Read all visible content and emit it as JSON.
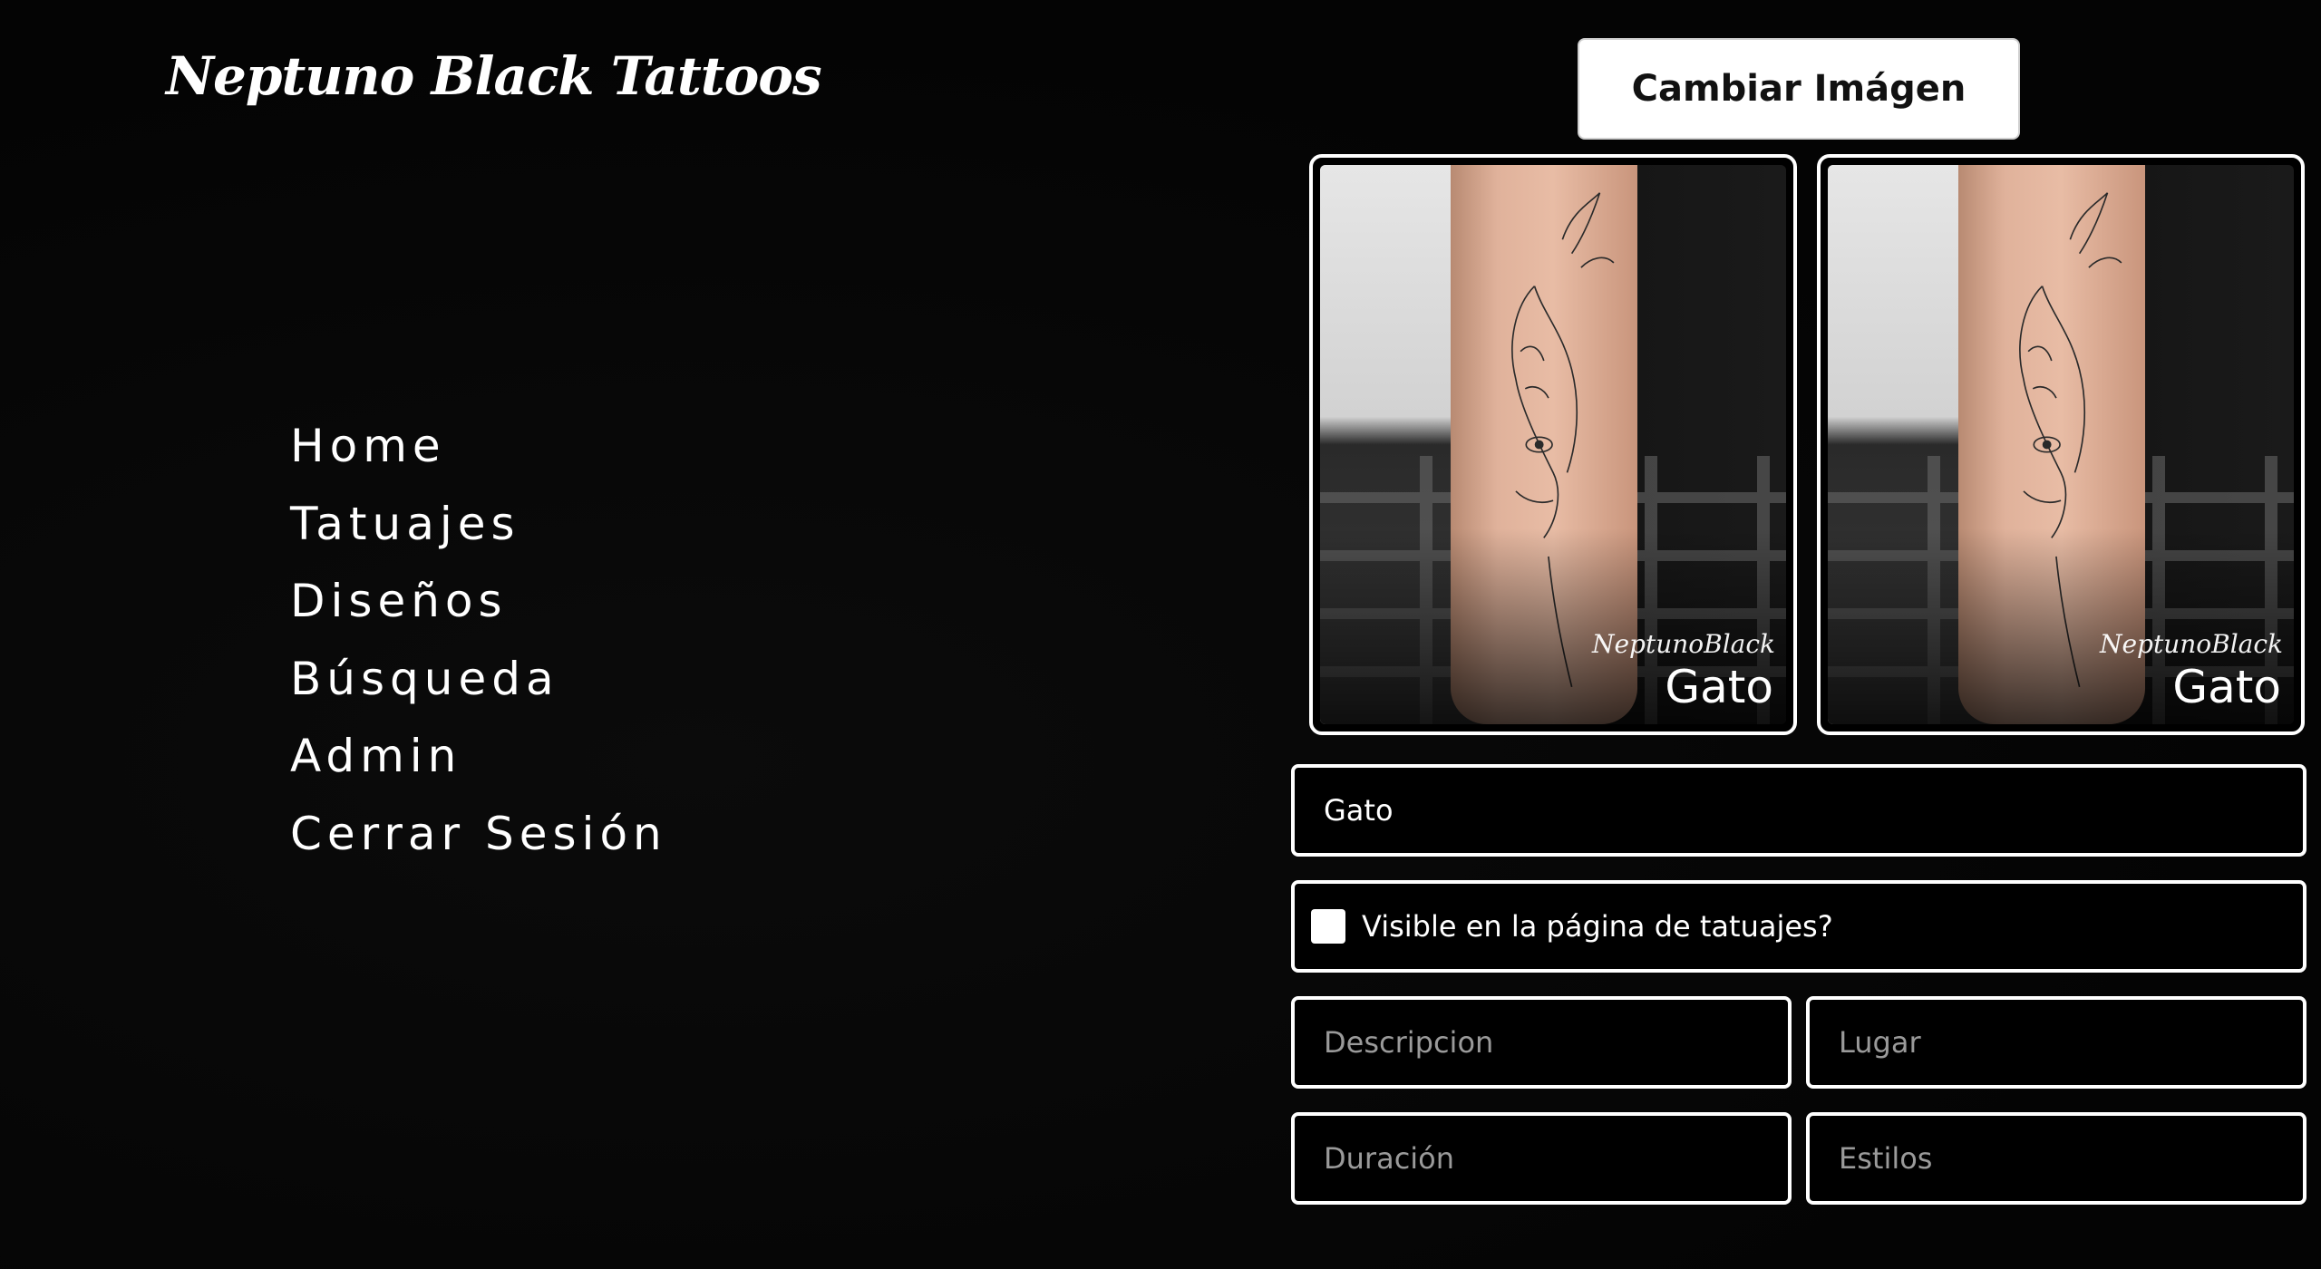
{
  "header": {
    "brand": "Neptuno Black Tattoos",
    "change_image_label": "Cambiar Imágen"
  },
  "nav": {
    "items": [
      {
        "label": "Home"
      },
      {
        "label": "Tatuajes"
      },
      {
        "label": "Diseños"
      },
      {
        "label": "Búsqueda"
      },
      {
        "label": "Admin"
      },
      {
        "label": "Cerrar Sesión"
      }
    ]
  },
  "previews": [
    {
      "caption": "Gato",
      "signature": "NeptunoBlack"
    },
    {
      "caption": "Gato",
      "signature": "NeptunoBlack"
    }
  ],
  "form": {
    "name_value": "Gato",
    "visible_label": "Visible en la página de tatuajes?",
    "description_placeholder": "Descripcion",
    "place_placeholder": "Lugar",
    "duration_placeholder": "Duración",
    "styles_placeholder": "Estilos"
  },
  "colors": {
    "background": "#050505",
    "text": "#ffffff",
    "button_bg": "#ffffff",
    "placeholder": "#9a9a9a"
  }
}
